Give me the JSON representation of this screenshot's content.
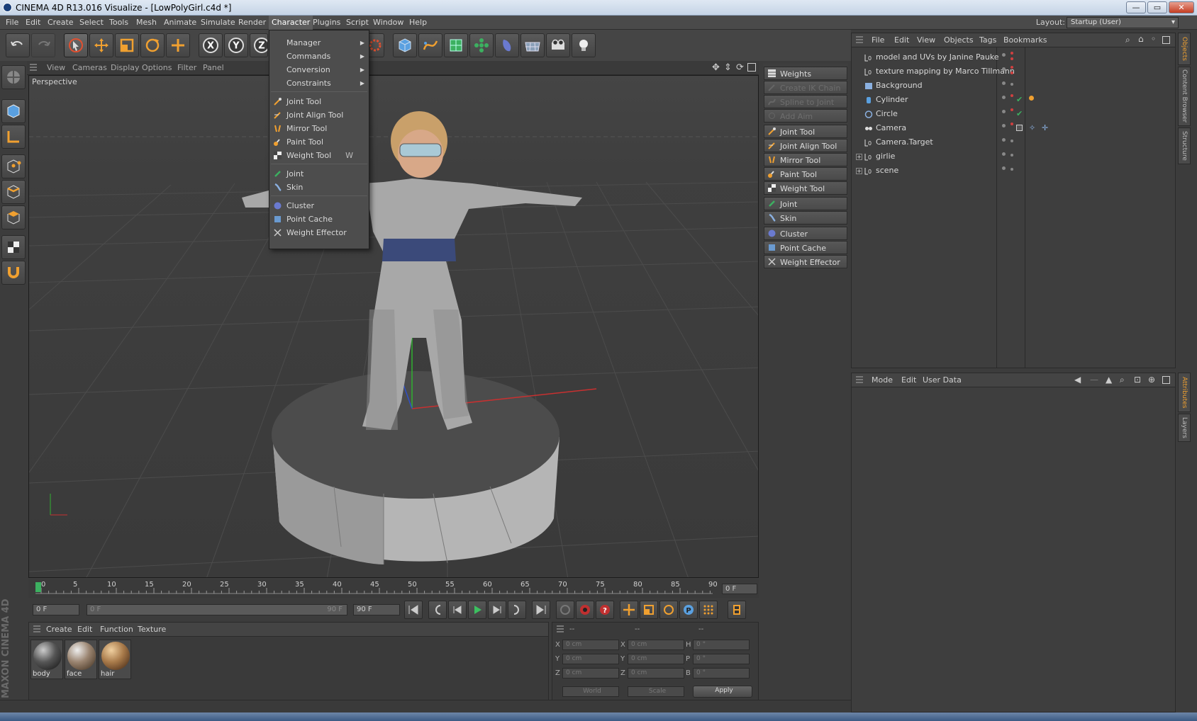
{
  "window": {
    "title": "CINEMA 4D R13.016 Visualize - [LowPolyGirl.c4d *]",
    "min_label": "—",
    "max_label": "▭",
    "close_label": "✕"
  },
  "menubar": {
    "items": [
      "File",
      "Edit",
      "Create",
      "Select",
      "Tools",
      "Mesh",
      "Animate",
      "Simulate",
      "Render",
      "Character",
      "Plugins",
      "Script",
      "Window",
      "Help"
    ],
    "active": "Character",
    "layout_label": "Layout:",
    "layout_value": "Startup (User)"
  },
  "toolbar": {
    "icons": [
      "undo-icon",
      "redo-icon",
      "live-selection-icon",
      "move-icon",
      "scale-icon",
      "rotate-icon",
      "axis-icon",
      "x-axis-icon",
      "y-axis-icon",
      "z-axis-icon",
      "render-settings-icon",
      "cube-icon",
      "spline-pen-icon",
      "subdivision-icon",
      "array-icon",
      "deformer-icon",
      "floor-icon",
      "camera-icon",
      "light-icon"
    ]
  },
  "viewport": {
    "menus": [
      "View",
      "Cameras",
      "Display",
      "Options",
      "Filter",
      "Panel"
    ],
    "label": "Perspective"
  },
  "character_menu": {
    "items": [
      {
        "label": "Manager",
        "submenu": true
      },
      {
        "label": "Commands",
        "submenu": true
      },
      {
        "label": "Conversion",
        "submenu": true
      },
      {
        "label": "Constraints",
        "submenu": true
      },
      {
        "label": "Joint Tool",
        "icon": "joint-tool-icon"
      },
      {
        "label": "Joint Align Tool",
        "icon": "joint-align-icon"
      },
      {
        "label": "Mirror Tool",
        "icon": "mirror-tool-icon"
      },
      {
        "label": "Paint Tool",
        "icon": "paint-tool-icon"
      },
      {
        "label": "Weight Tool",
        "icon": "weight-tool-icon",
        "shortcut": "W"
      },
      {
        "label": "Joint",
        "icon": "joint-icon"
      },
      {
        "label": "Skin",
        "icon": "skin-icon"
      },
      {
        "label": "Cluster",
        "icon": "cluster-icon"
      },
      {
        "label": "Point Cache",
        "icon": "point-cache-icon"
      },
      {
        "label": "Weight Effector",
        "icon": "weight-effector-icon"
      }
    ]
  },
  "character_palette": {
    "items": [
      {
        "label": "Weights Manager...",
        "enabled": true
      },
      {
        "label": "Create IK Chain",
        "enabled": false
      },
      {
        "label": "Spline to Joint",
        "enabled": false
      },
      {
        "label": "Add Aim Constraint",
        "enabled": false
      },
      {
        "label": "Joint Tool",
        "enabled": true
      },
      {
        "label": "Joint Align Tool",
        "enabled": true
      },
      {
        "label": "Mirror Tool",
        "enabled": true
      },
      {
        "label": "Paint Tool",
        "enabled": true
      },
      {
        "label": "Weight Tool",
        "enabled": true
      },
      {
        "label": "Joint",
        "enabled": true
      },
      {
        "label": "Skin",
        "enabled": true
      },
      {
        "label": "Cluster",
        "enabled": true
      },
      {
        "label": "Point Cache",
        "enabled": true
      },
      {
        "label": "Weight Effector",
        "enabled": true
      }
    ]
  },
  "object_manager": {
    "menus": [
      "File",
      "Edit",
      "View",
      "Objects",
      "Tags",
      "Bookmarks"
    ],
    "objects": [
      {
        "name": "model and UVs by Janine Pauke",
        "icon": "null-icon"
      },
      {
        "name": "texture mapping by Marco Tillmann",
        "icon": "null-icon"
      },
      {
        "name": "Background",
        "icon": "background-icon"
      },
      {
        "name": "Cylinder",
        "icon": "cylinder-icon"
      },
      {
        "name": "Circle",
        "icon": "circle-icon"
      },
      {
        "name": "Camera",
        "icon": "camera-icon"
      },
      {
        "name": "Camera.Target",
        "icon": "null-icon"
      },
      {
        "name": "girlie",
        "icon": "null-icon",
        "expandable": true
      },
      {
        "name": "scene",
        "icon": "null-icon",
        "expandable": true
      }
    ]
  },
  "attribute_manager": {
    "menus": [
      "Mode",
      "Edit",
      "User Data"
    ]
  },
  "side_tabs": [
    "Objects",
    "Content Browser",
    "Structure",
    "Attributes",
    "Layers"
  ],
  "timeline": {
    "ticks": [
      "0",
      "5",
      "10",
      "15",
      "20",
      "25",
      "30",
      "35",
      "40",
      "45",
      "50",
      "55",
      "60",
      "65",
      "70",
      "75",
      "80",
      "85",
      "90"
    ],
    "current_frame": "0 F"
  },
  "playback": {
    "start_field": "0 F",
    "range_start": "0 F",
    "range_end": "90 F",
    "end_field": "90 F"
  },
  "material_manager": {
    "menus": [
      "Create",
      "Edit",
      "Function",
      "Texture"
    ],
    "materials": [
      {
        "name": "body",
        "color": "#555555"
      },
      {
        "name": "face",
        "color": "#9a8470"
      },
      {
        "name": "hair",
        "color": "#a87a4a"
      }
    ]
  },
  "coordinates": {
    "headers": [
      "--",
      "--",
      "--"
    ],
    "rows": [
      {
        "l1": "X",
        "v1": "0 cm",
        "l2": "X",
        "v2": "0 cm",
        "l3": "H",
        "v3": "0 °"
      },
      {
        "l1": "Y",
        "v1": "0 cm",
        "l2": "Y",
        "v2": "0 cm",
        "l3": "P",
        "v3": "0 °"
      },
      {
        "l1": "Z",
        "v1": "0 cm",
        "l2": "Z",
        "v2": "0 cm",
        "l3": "B",
        "v3": "0 °"
      }
    ],
    "mode1": "World",
    "mode2": "Scale",
    "apply_label": "Apply"
  },
  "branding": {
    "logo_text": "MAXON CINEMA 4D"
  },
  "colors": {
    "accent_orange": "#f0a030",
    "selection_blue": "#5aa0e0",
    "x_red": "#c83030",
    "y_green": "#30b030"
  }
}
